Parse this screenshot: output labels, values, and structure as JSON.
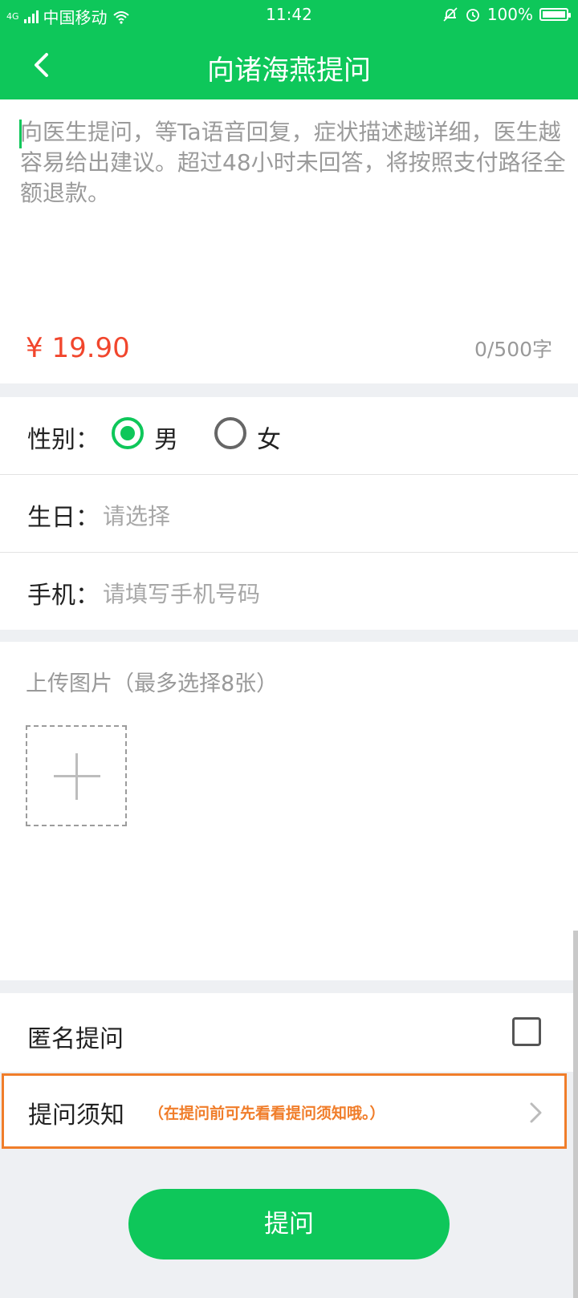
{
  "status_bar": {
    "network": "4G",
    "carrier": "中国移动",
    "time": "11:42",
    "battery": "100%"
  },
  "header": {
    "title": "向诸海燕提问",
    "back_icon": "chevron-left-icon"
  },
  "question": {
    "placeholder": "向医生提问，等Ta语音回复，症状描述越详细，医生越容易给出建议。超过48小时未回答，将按照支付路径全额退款。",
    "price": "¥ 19.90",
    "counter": "0/500字"
  },
  "form": {
    "gender_label": "性别：",
    "gender_options": [
      {
        "label": "男",
        "selected": true
      },
      {
        "label": "女",
        "selected": false
      }
    ],
    "birthday_label": "生日：",
    "birthday_placeholder": "请选择",
    "phone_label": "手机：",
    "phone_placeholder": "请填写手机号码"
  },
  "upload": {
    "title": "上传图片（最多选择8张）",
    "add_icon": "plus-icon"
  },
  "options": {
    "anonymous_label": "匿名提问",
    "anonymous_checked": false,
    "notice_label": "提问须知",
    "notice_hint": "（在提问前可先看看提问须知哦。）",
    "notice_icon": "chevron-right-icon"
  },
  "submit_label": "提问",
  "colors": {
    "brand_green": "#0ec75a",
    "price_red": "#f1462d",
    "highlight_orange": "#f07d2a"
  }
}
